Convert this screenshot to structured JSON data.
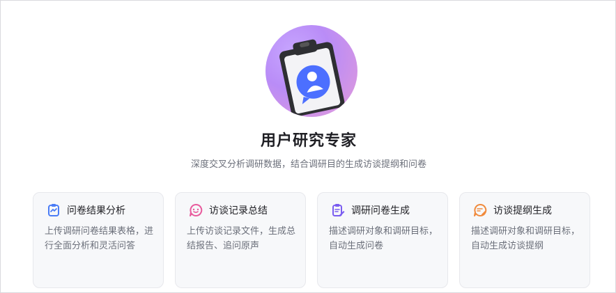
{
  "hero": {
    "icon": "clipboard-user-icon"
  },
  "title": "用户研究专家",
  "subtitle": "深度交叉分析调研数据，结合调研目的生成访谈提纲和问卷",
  "cards": [
    {
      "icon": "survey-chart-icon",
      "color": "#4a7cf6",
      "title": "问卷结果分析",
      "desc": "上传调研问卷结果表格，进行全面分析和灵活问答"
    },
    {
      "icon": "chat-bubble-icon",
      "color": "#e85a9c",
      "title": "访谈记录总结",
      "desc": "上传访谈记录文件，生成总结报告、追问原声"
    },
    {
      "icon": "doc-edit-icon",
      "color": "#7a5cf0",
      "title": "调研问卷生成",
      "desc": "描述调研对象和调研目标，自动生成问卷"
    },
    {
      "icon": "chat-edit-icon",
      "color": "#f08a3c",
      "title": "访谈提纲生成",
      "desc": "描述调研对象和调研目标，自动生成访谈提纲"
    }
  ]
}
